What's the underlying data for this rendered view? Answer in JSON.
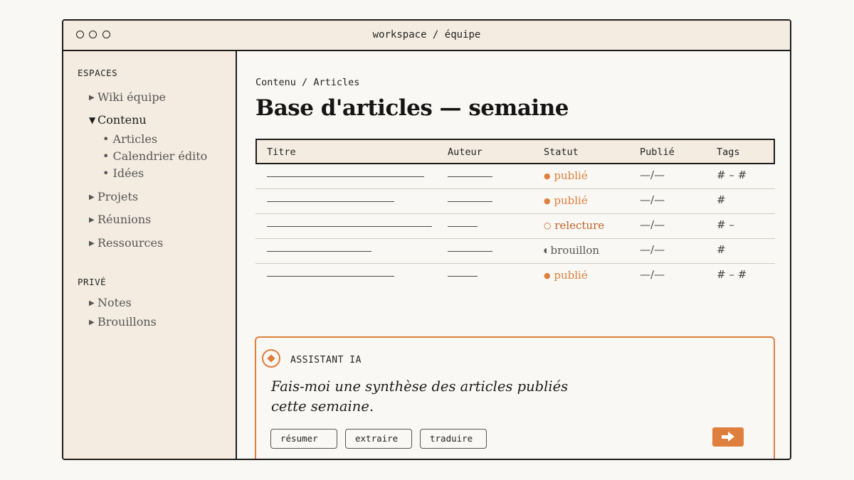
{
  "window": {
    "title": "workspace / équipe"
  },
  "sidebar": {
    "sections": [
      {
        "label": "ESPACES"
      },
      {
        "label": "PRIVÉ"
      }
    ],
    "espaces": [
      {
        "label": "Wiki équipe",
        "expanded": false
      },
      {
        "label": "Contenu",
        "expanded": true
      },
      {
        "label": "Projets",
        "expanded": false
      },
      {
        "label": "Réunions",
        "expanded": false
      },
      {
        "label": "Ressources",
        "expanded": false
      }
    ],
    "contenu_children": [
      "Articles",
      "Calendrier édito",
      "Idées"
    ],
    "prive": [
      {
        "label": "Notes"
      },
      {
        "label": "Brouillons"
      }
    ]
  },
  "breadcrumb": {
    "parent": "Contenu",
    "separator": "/",
    "current": "Articles"
  },
  "page": {
    "title": "Base d'articles — semaine"
  },
  "table": {
    "columns": [
      "Titre",
      "Auteur",
      "Statut",
      "Publié",
      "Tags"
    ],
    "rows": [
      {
        "status": "publié",
        "status_icon": "●",
        "published": "—/—",
        "tags": "# – #"
      },
      {
        "status": "publié",
        "status_icon": "●",
        "published": "—/—",
        "tags": "#"
      },
      {
        "status": "relecture",
        "status_icon": "○",
        "published": "—/—",
        "tags": "# –"
      },
      {
        "status": "brouillon",
        "status_icon": "◖",
        "published": "—/—",
        "tags": "#"
      },
      {
        "status": "publié",
        "status_icon": "●",
        "published": "—/—",
        "tags": "# – #"
      }
    ]
  },
  "assistant": {
    "label": "ASSISTANT IA",
    "prompt": "Fais-moi une synthèse des articles publiés cette semaine.",
    "chips": [
      "résumer",
      "extraire",
      "traduire"
    ]
  },
  "colors": {
    "accent": "#de7f3d",
    "sidebar_bg": "#f4ece1",
    "page_bg": "#faf8f4",
    "ink": "#1c1c1c"
  }
}
